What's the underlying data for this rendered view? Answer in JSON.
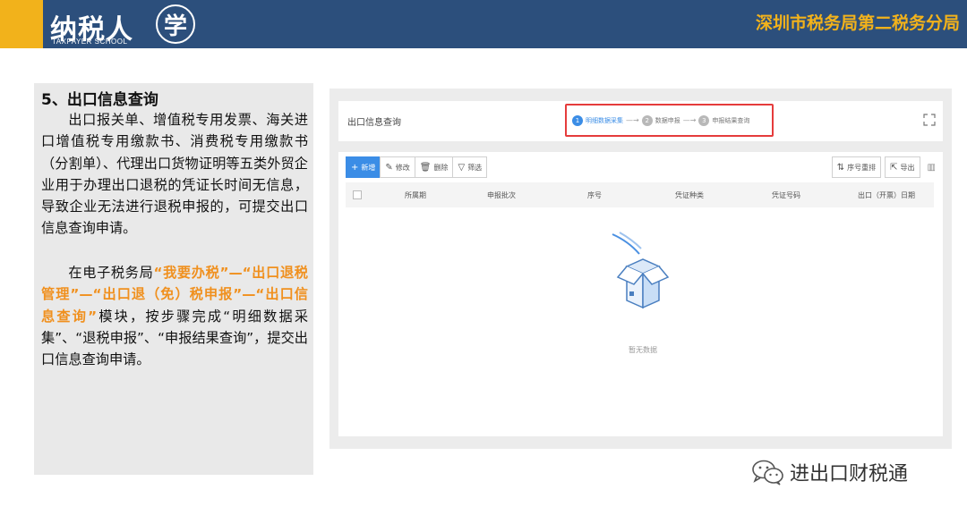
{
  "header": {
    "logo_text": "纳税人",
    "logo_sub": "TAXPAYER SCHOOL",
    "logo_badge": "学",
    "org": "深圳市税务局第二税务分局"
  },
  "left": {
    "title": "5、出口信息查询",
    "p1": "出口报关单、增值税专用发票、海关进口增值税专用缴款书、消费税专用缴款书（分割单）、代理出口货物证明等五类外贸企业用于办理出口退税的凭证长时间无信息，导致企业无法进行退税申报的，可提交出口信息查询申请。",
    "p2_a": "在电子税务局",
    "p2_hl1": "“我要办税”—“出口退税管理”—“出口退（免）税申报”—“出口信息查询”",
    "p2_b": "模块，按步骤完成“明细数据采集”、“退税申报”、“申报结果查询”，提交出口信息查询申请。"
  },
  "app": {
    "page_name": "出口信息查询",
    "steps": [
      {
        "num": "1",
        "label": "明细数据采集"
      },
      {
        "num": "2",
        "label": "数据申报"
      },
      {
        "num": "3",
        "label": "申报结果查询"
      }
    ],
    "toolbar": {
      "add": "新增",
      "edit": "修改",
      "delete": "删除",
      "filter": "筛选",
      "sort": "序号重排",
      "export": "导出"
    },
    "columns": [
      "所属期",
      "申报批次",
      "序号",
      "凭证种类",
      "凭证号码",
      "出口（开票）日期"
    ],
    "empty_text": "暂无数据"
  },
  "watermark": {
    "text": "进出口财税通",
    "icon": "wechat-icon"
  },
  "colors": {
    "header_bg": "#2c4f7c",
    "accent": "#f2b21b",
    "highlight": "#f0901e",
    "primary": "#3b8de6",
    "step_border": "#e53c3c"
  }
}
